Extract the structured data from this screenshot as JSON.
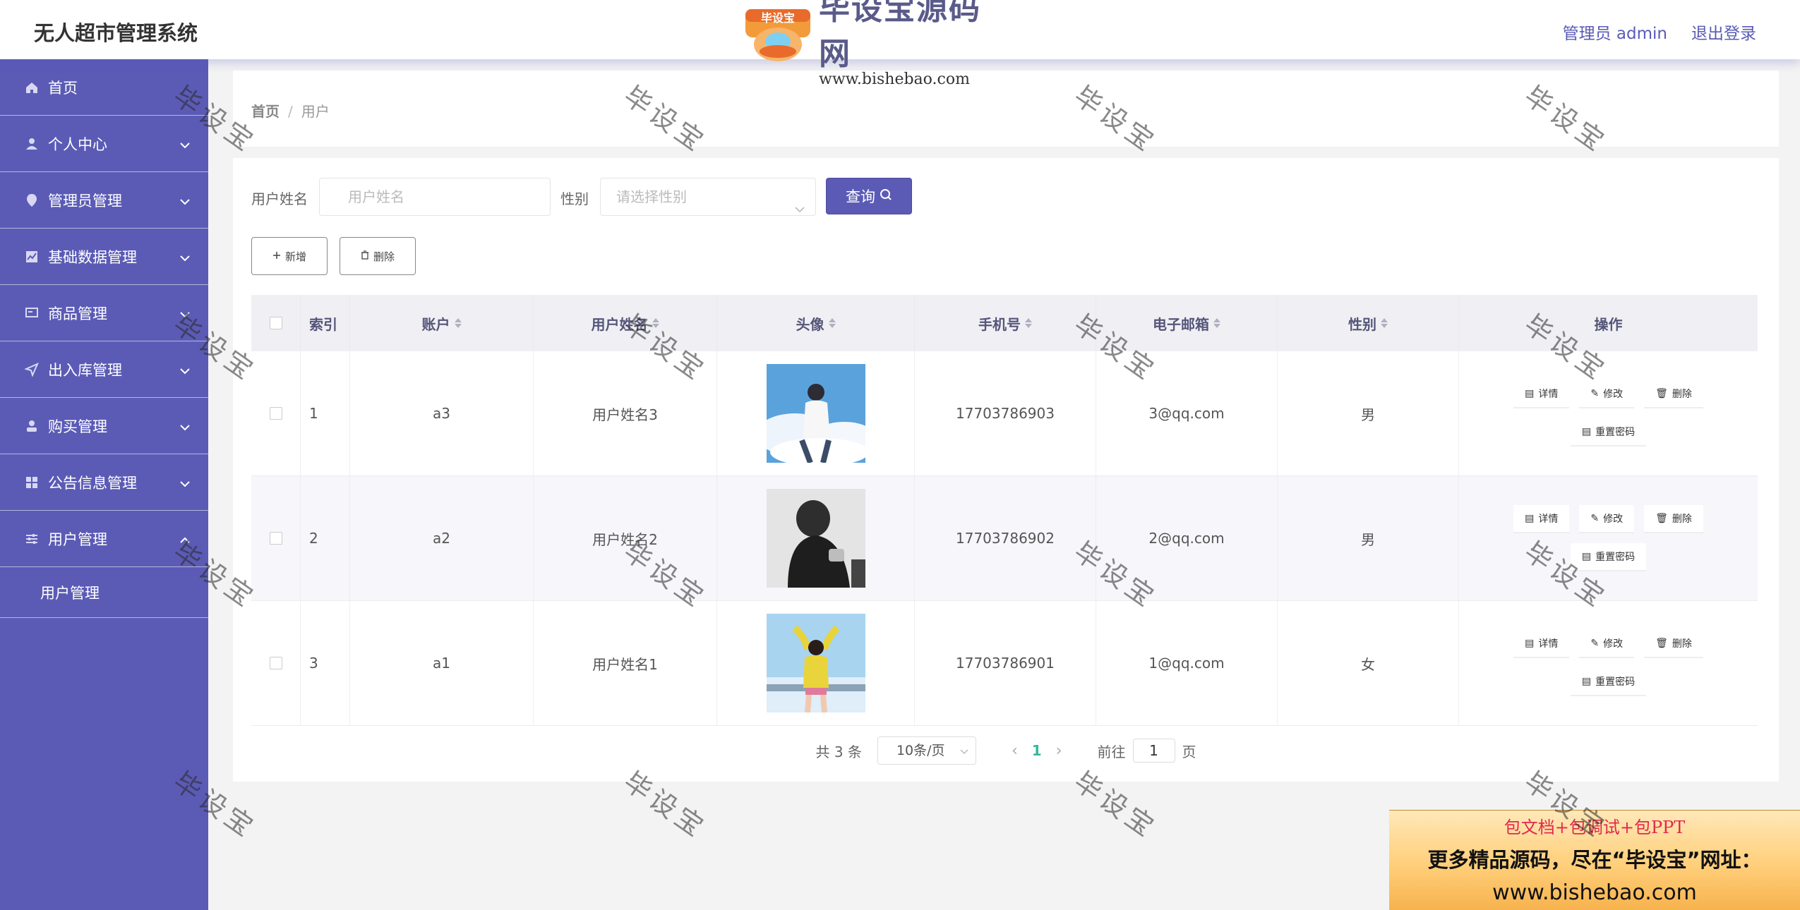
{
  "app": {
    "title": "无人超市管理系统"
  },
  "header": {
    "admin_label": "管理员 admin",
    "logout_label": "退出登录"
  },
  "brand": {
    "name": "毕设宝源码网",
    "url": "www.bishebao.com",
    "badge": "毕设宝"
  },
  "sidebar": {
    "items": [
      {
        "label": "首页",
        "icon": "home-icon"
      },
      {
        "label": "个人中心",
        "icon": "user-icon"
      },
      {
        "label": "管理员管理",
        "icon": "location-icon"
      },
      {
        "label": "基础数据管理",
        "icon": "chart-icon"
      },
      {
        "label": "商品管理",
        "icon": "monitor-icon"
      },
      {
        "label": "出入库管理",
        "icon": "send-icon"
      },
      {
        "label": "购买管理",
        "icon": "person-icon"
      },
      {
        "label": "公告信息管理",
        "icon": "grid-icon"
      },
      {
        "label": "用户管理",
        "icon": "sliders-icon"
      }
    ],
    "sub_item": "用户管理"
  },
  "breadcrumb": {
    "home": "首页",
    "separator": "/",
    "current": "用户"
  },
  "filters": {
    "name_label": "用户姓名",
    "name_placeholder": "用户姓名",
    "gender_label": "性别",
    "gender_placeholder": "请选择性别",
    "search_label": "查询"
  },
  "actions": {
    "add_label": "新增",
    "delete_label": "删除"
  },
  "table": {
    "headers": {
      "index": "索引",
      "account": "账户",
      "name": "用户姓名",
      "avatar": "头像",
      "phone": "手机号",
      "email": "电子邮箱",
      "gender": "性别",
      "ops": "操作"
    },
    "rows": [
      {
        "index": "1",
        "account": "a3",
        "name": "用户姓名3",
        "phone": "17703786903",
        "email": "3@qq.com",
        "gender": "男"
      },
      {
        "index": "2",
        "account": "a2",
        "name": "用户姓名2",
        "phone": "17703786902",
        "email": "2@qq.com",
        "gender": "男"
      },
      {
        "index": "3",
        "account": "a1",
        "name": "用户姓名1",
        "phone": "17703786901",
        "email": "1@qq.com",
        "gender": "女"
      }
    ],
    "op_labels": {
      "detail": "详情",
      "edit": "修改",
      "delete": "删除",
      "reset": "重置密码"
    }
  },
  "pagination": {
    "total": "共 3 条",
    "page_size": "10条/页",
    "current_page": "1",
    "goto_prefix": "前往",
    "goto_value": "1",
    "goto_suffix": "页"
  },
  "promo": {
    "line1": "包文档+包调试+包PPT",
    "line2": "更多精品源码，尽在“毕设宝”网址：",
    "line3": "www.bishebao.com"
  },
  "watermark": {
    "text": "毕设宝"
  },
  "colors": {
    "primary": "#5b5bb6",
    "page_active": "#35b89a",
    "promo_red": "#e2284d"
  }
}
